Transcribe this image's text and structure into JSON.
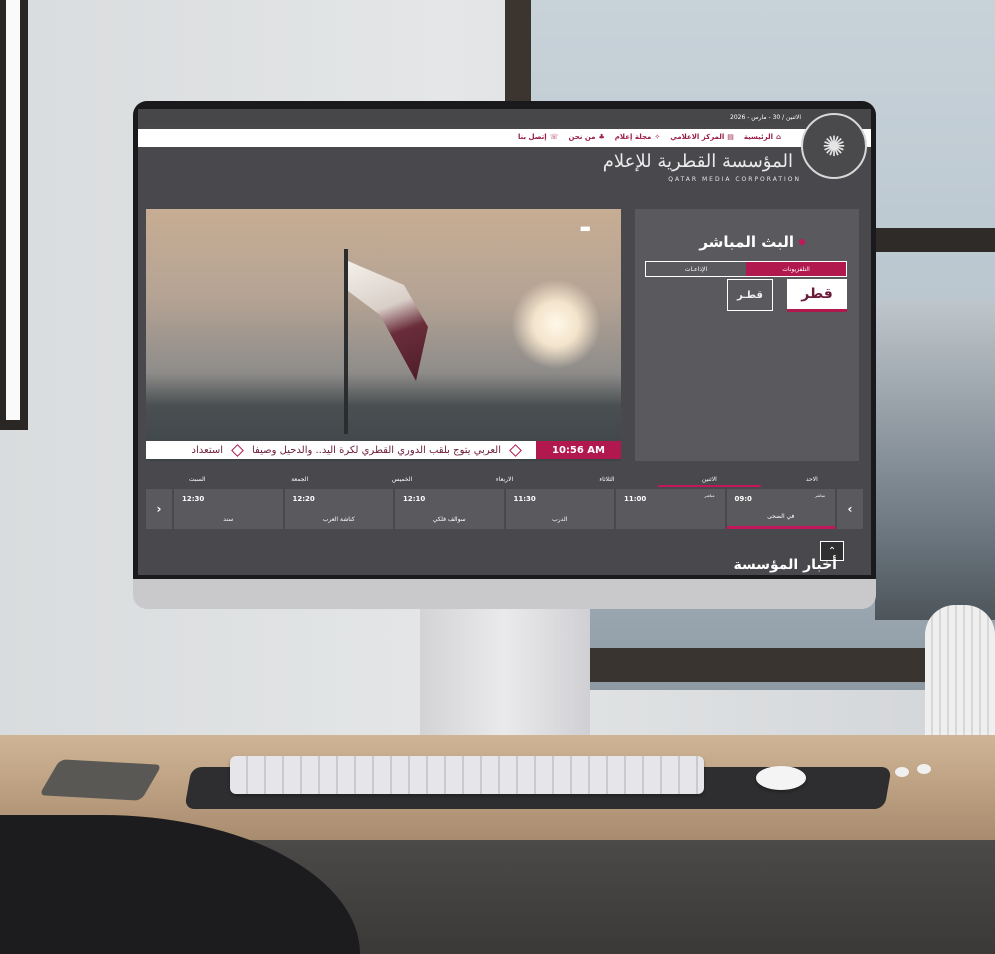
{
  "header": {
    "date": "الاثنين / 30 - مارس - 2026",
    "nav": [
      {
        "label": "الرئيسية",
        "icon": "home-icon"
      },
      {
        "label": "المركز الاعلامي",
        "icon": "document-icon"
      },
      {
        "label": "مجلة إعلام",
        "icon": "magazine-icon"
      },
      {
        "label": "من نحن",
        "icon": "people-icon"
      },
      {
        "label": "إتصل بنا",
        "icon": "phone-icon"
      }
    ],
    "logo_ar": "المؤسسة القطرية للإعلام",
    "logo_en": "QATAR MEDIA CORPORATION"
  },
  "live": {
    "title": "البث المباشر",
    "tabs": [
      "التلفزيونات",
      "الإذاعـات"
    ],
    "channels": [
      "قطر",
      "قطـر"
    ]
  },
  "video": {
    "clock": "10:56 AM",
    "ticker": [
      "العربي يتوج بلقب الدوري القطري لكرة اليد.. والدحيل وصيفا",
      "استعداد"
    ]
  },
  "schedule": {
    "days": [
      "الاحد",
      "الاثنين",
      "الثلاثاء",
      "الاربعاء",
      "الخميس",
      "الجمعة",
      "السبت"
    ],
    "programs": [
      {
        "time": "09:0",
        "name": "في الضحى",
        "live": "مباشر"
      },
      {
        "time": "11:00",
        "name": "",
        "live": "مباشر"
      },
      {
        "time": "11:30",
        "name": "الدرب",
        "live": ""
      },
      {
        "time": "12:10",
        "name": "سوالف فلكي",
        "live": ""
      },
      {
        "time": "12:20",
        "name": "كناشة العرب",
        "live": ""
      },
      {
        "time": "12:30",
        "name": "سند",
        "live": ""
      }
    ]
  },
  "news_heading": "أخبار المؤسسة"
}
